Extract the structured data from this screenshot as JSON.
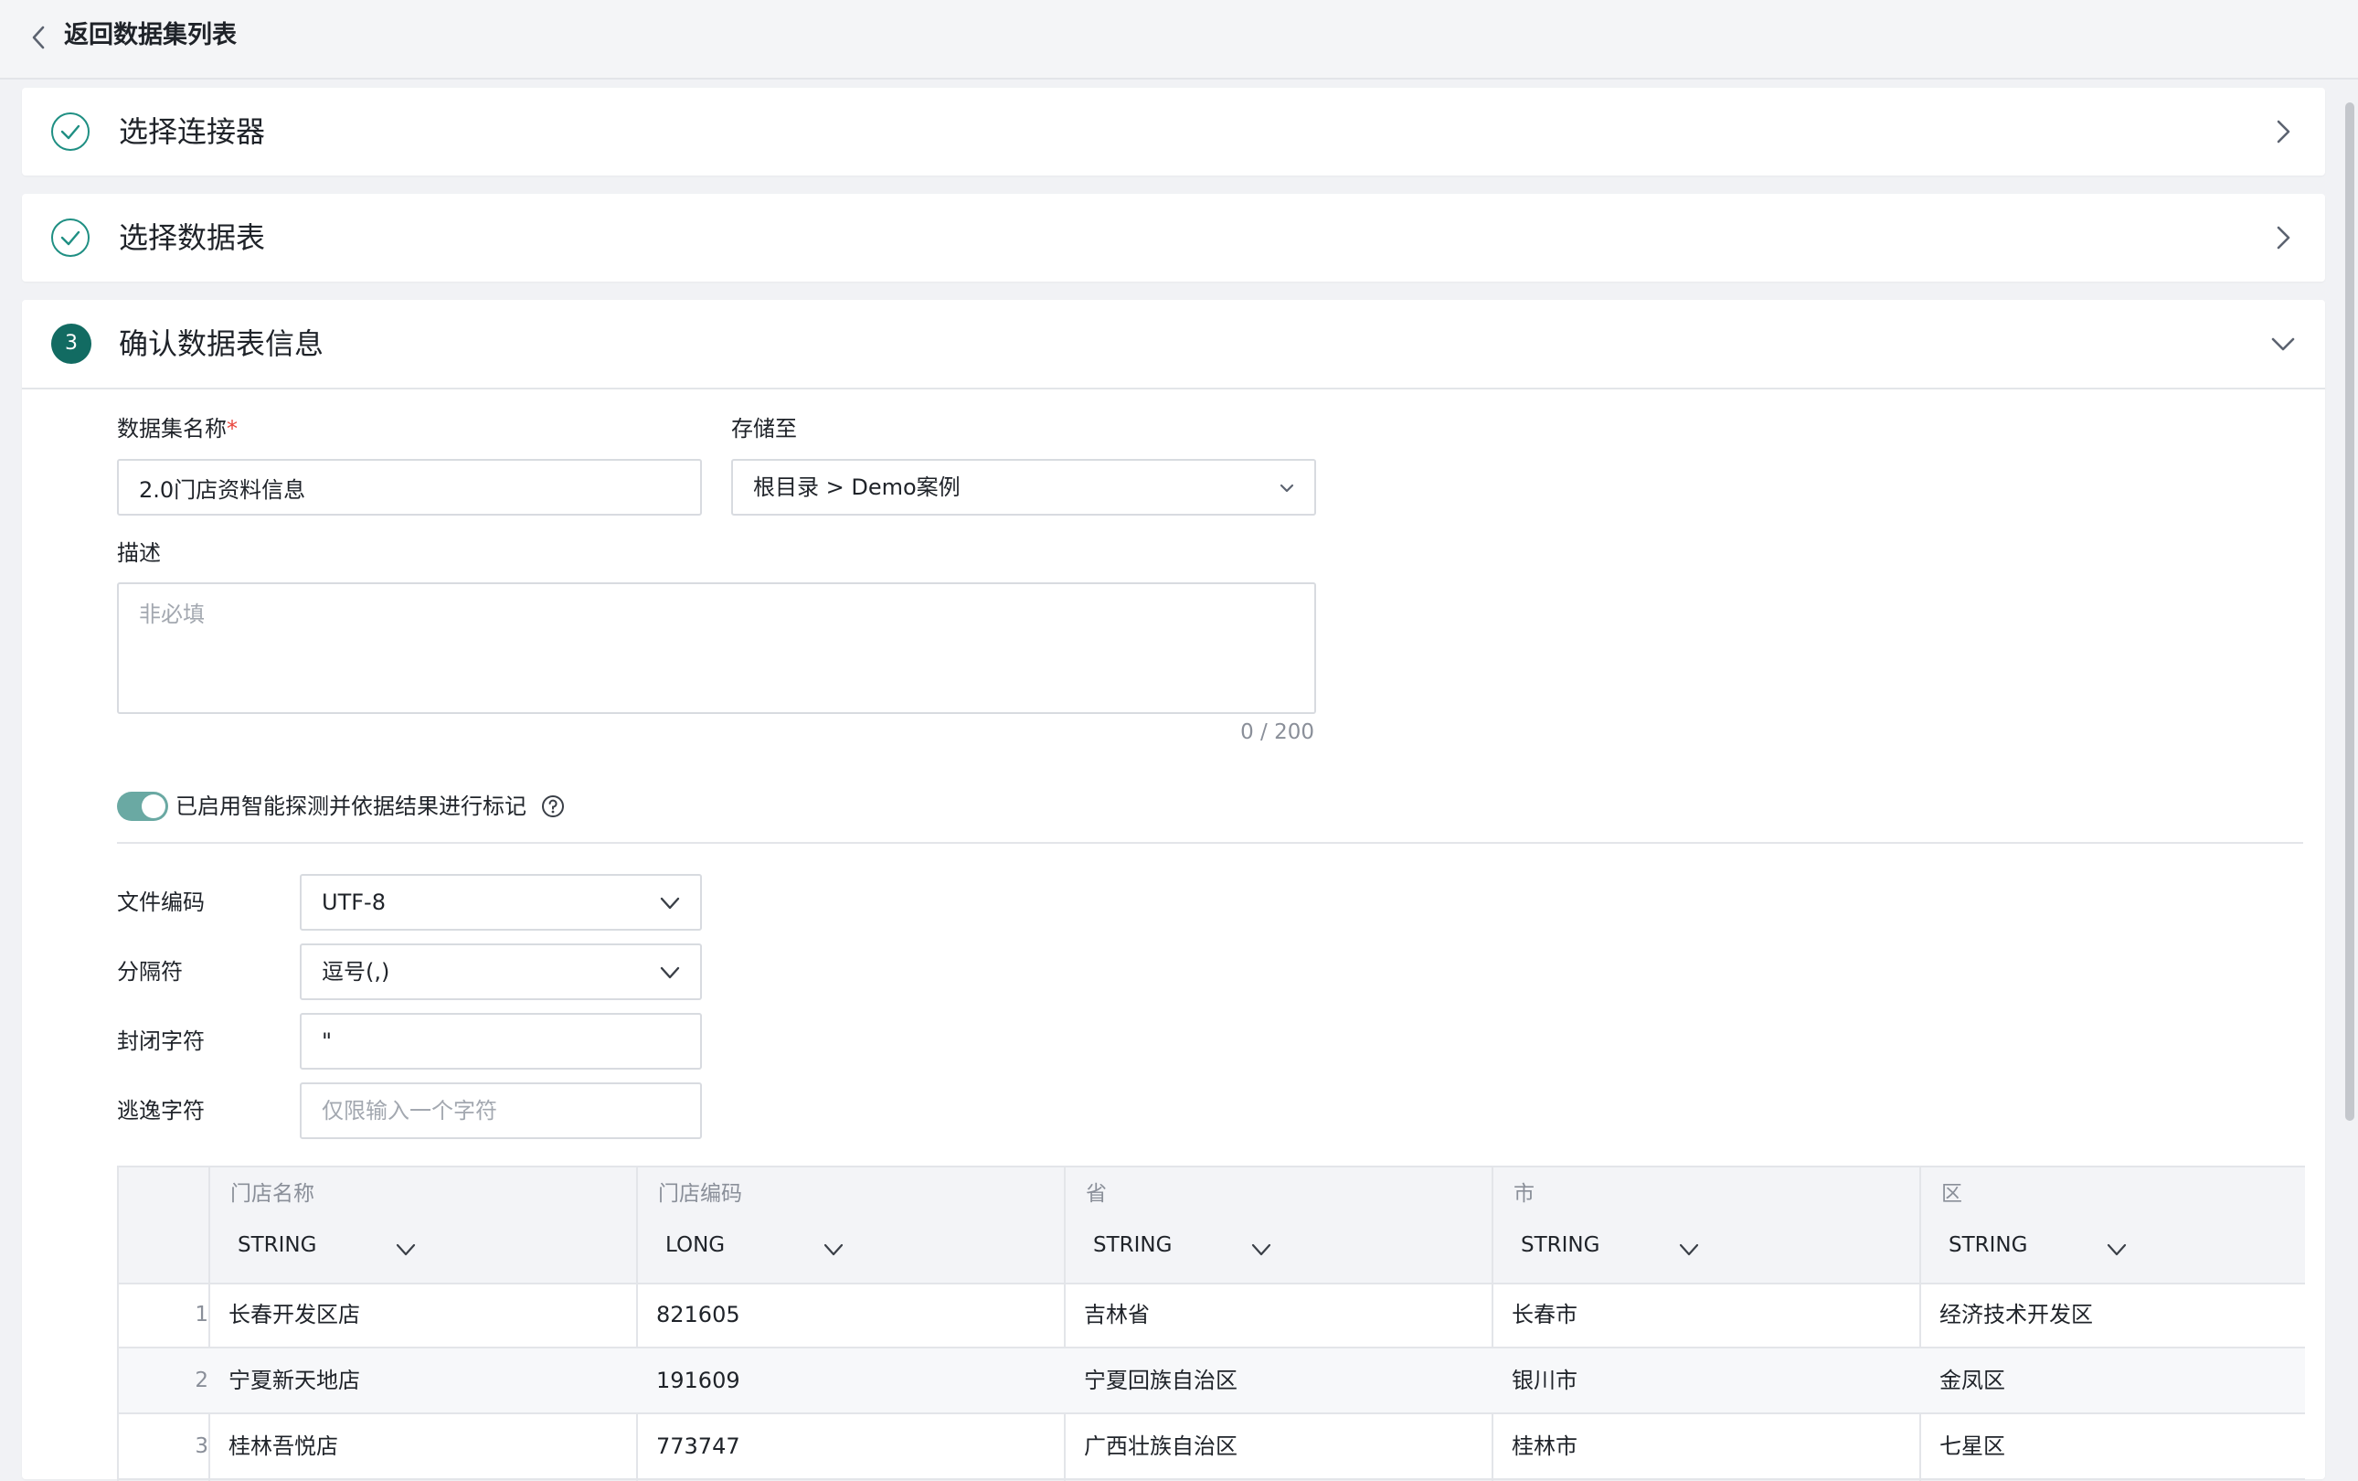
{
  "header": {
    "back_label": "返回数据集列表"
  },
  "steps": [
    {
      "label": "选择连接器",
      "status": "done"
    },
    {
      "label": "选择数据表",
      "status": "done"
    },
    {
      "number": "3",
      "label": "确认数据表信息",
      "status": "active"
    }
  ],
  "form": {
    "dataset_name_label": "数据集名称",
    "required_mark": "*",
    "dataset_name_value": "2.0门店资料信息",
    "store_to_label": "存储至",
    "store_to_value": "根目录 > Demo案例",
    "description_label": "描述",
    "description_placeholder": "非必填",
    "description_counter": "0 / 200",
    "smart_detect_label": "已启用智能探测并依据结果进行标记",
    "smart_detect_enabled": true,
    "file_encoding_label": "文件编码",
    "file_encoding_value": "UTF-8",
    "delimiter_label": "分隔符",
    "delimiter_value": "逗号(,)",
    "enclosure_label": "封闭字符",
    "enclosure_value": "\"",
    "escape_label": "逃逸字符",
    "escape_placeholder": "仅限输入一个字符"
  },
  "table": {
    "columns": [
      {
        "name": "门店名称",
        "type": "STRING"
      },
      {
        "name": "门店编码",
        "type": "LONG"
      },
      {
        "name": "省",
        "type": "STRING"
      },
      {
        "name": "市",
        "type": "STRING"
      },
      {
        "name": "区",
        "type": "STRING"
      }
    ],
    "rows": [
      {
        "index": "1",
        "cells": [
          "长春开发区店",
          "821605",
          "吉林省",
          "长春市",
          "经济技术开发区"
        ]
      },
      {
        "index": "2",
        "cells": [
          "宁夏新天地店",
          "191609",
          "宁夏回族自治区",
          "银川市",
          "金凤区"
        ]
      },
      {
        "index": "3",
        "cells": [
          "桂林吾悦店",
          "773747",
          "广西壮族自治区",
          "桂林市",
          "七星区"
        ]
      }
    ]
  },
  "colors": {
    "accent": "#126b62",
    "check": "#1f8f83",
    "toggle": "#6aa9a3",
    "required": "#e8453c"
  }
}
